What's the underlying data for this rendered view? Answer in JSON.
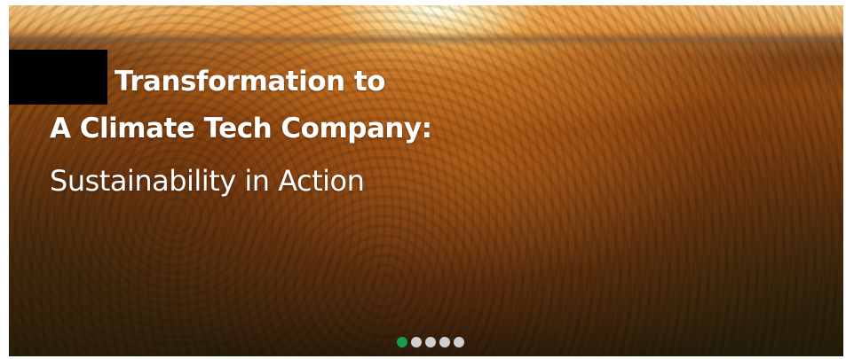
{
  "hero": {
    "headline_line1": "Transformation to",
    "headline_line2": "A Climate Tech Company:",
    "subheadline": "Sustainability in Action",
    "background": "forest canopy at sunset",
    "redacted_block": true
  },
  "carousel": {
    "slide_count": 5,
    "active_index": 0,
    "active_color": "#1a9b4a",
    "inactive_color": "#cfcfcf"
  }
}
